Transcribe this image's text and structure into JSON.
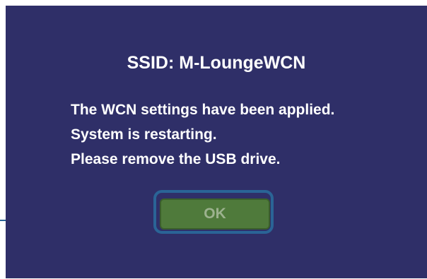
{
  "dialog": {
    "ssid_title": "SSID: M-LoungeWCN",
    "message_lines": [
      "The WCN settings have been applied.",
      "System is restarting.",
      "Please remove the USB drive."
    ],
    "ok_label": "OK"
  },
  "colors": {
    "screen_background": "#2f2f68",
    "text": "#ffffff",
    "ok_button": "#4f7a3b",
    "ok_label": "#9cb28e",
    "callout": "#2a6496"
  }
}
